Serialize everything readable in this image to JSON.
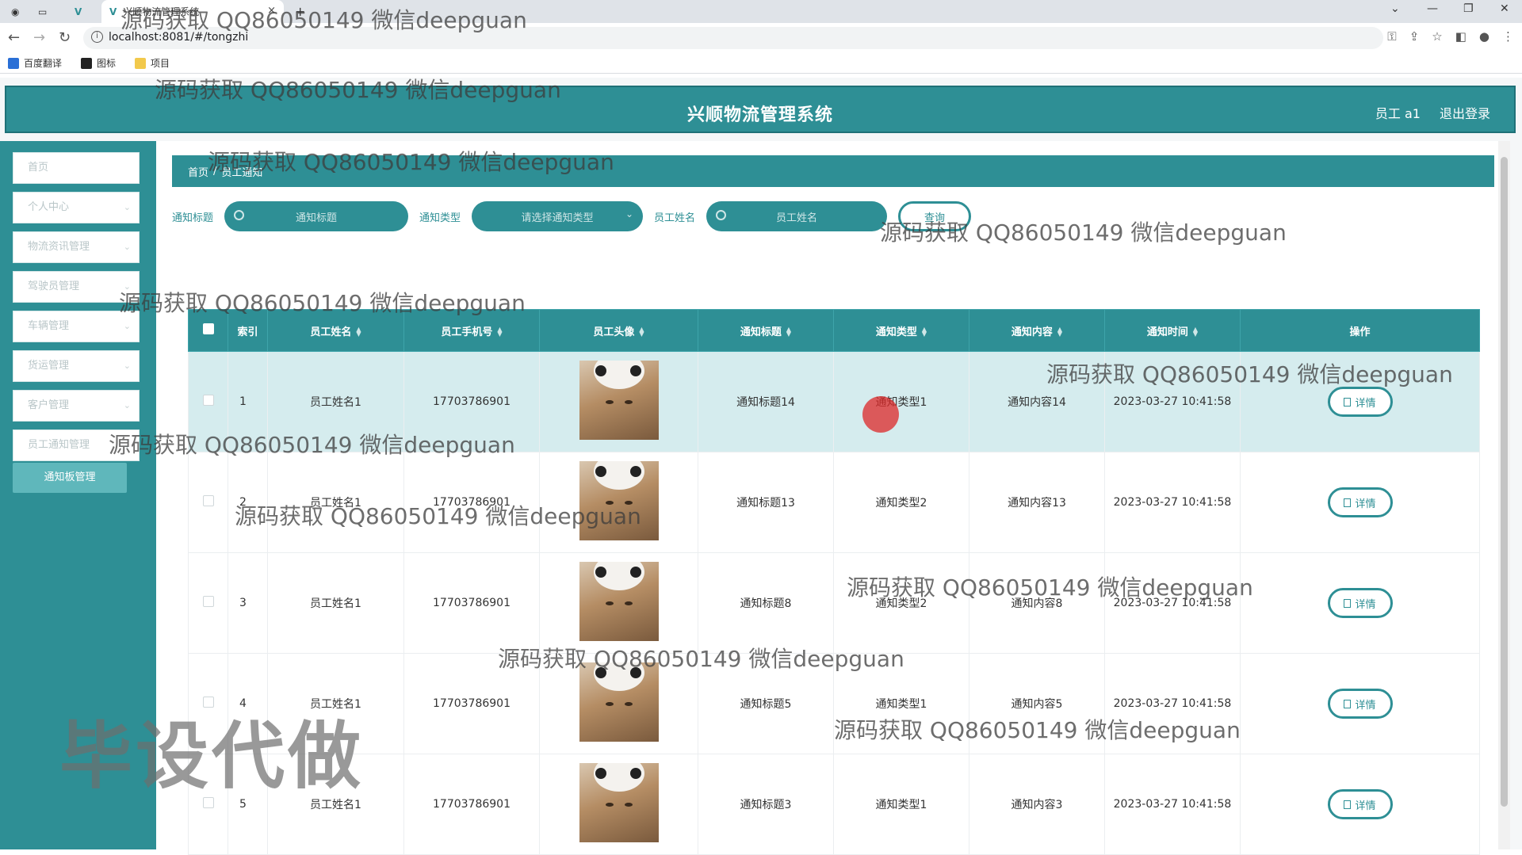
{
  "browser": {
    "tab_title": "兴顺物流管理系统",
    "tab_close": "×",
    "new_tab": "+",
    "url": "localhost:8081/#/tongzhi",
    "window_controls": [
      "⌄",
      "—",
      "❐",
      "✕"
    ]
  },
  "bookmarks": [
    {
      "label": "百度翻译",
      "color": "#2a6fd6"
    },
    {
      "label": "图标",
      "color": "#222222"
    },
    {
      "label": "项目",
      "color": "#f2c94c"
    }
  ],
  "header": {
    "title": "兴顺物流管理系统",
    "user": "员工 a1",
    "logout": "退出登录"
  },
  "sidebar": {
    "items": [
      {
        "label": "首页",
        "has_chevron": false
      },
      {
        "label": "个人中心",
        "has_chevron": true
      },
      {
        "label": "物流资讯管理",
        "has_chevron": true
      },
      {
        "label": "驾驶员管理",
        "has_chevron": true
      },
      {
        "label": "车辆管理",
        "has_chevron": true
      },
      {
        "label": "货运管理",
        "has_chevron": true
      },
      {
        "label": "客户管理",
        "has_chevron": true
      },
      {
        "label": "员工通知管理",
        "has_chevron": true
      }
    ],
    "active_sub": "通知板管理"
  },
  "breadcrumb": {
    "home": "首页",
    "sep": "/",
    "current": "员工通知"
  },
  "search": {
    "title_label": "通知标题",
    "title_placeholder": "通知标题",
    "type_label": "通知类型",
    "type_placeholder": "请选择通知类型",
    "name_label": "员工姓名",
    "name_placeholder": "员工姓名",
    "query_button": "查询"
  },
  "table": {
    "columns": [
      "索引",
      "员工姓名",
      "员工手机号",
      "员工头像",
      "通知标题",
      "通知类型",
      "通知内容",
      "通知时间",
      "操作"
    ],
    "detail_label": "详情",
    "rows": [
      {
        "index": "1",
        "name": "员工姓名1",
        "phone": "17703786901",
        "title": "通知标题14",
        "type": "通知类型1",
        "content": "通知内容14",
        "time": "2023-03-27 10:41:58"
      },
      {
        "index": "2",
        "name": "员工姓名1",
        "phone": "17703786901",
        "title": "通知标题13",
        "type": "通知类型2",
        "content": "通知内容13",
        "time": "2023-03-27 10:41:58"
      },
      {
        "index": "3",
        "name": "员工姓名1",
        "phone": "17703786901",
        "title": "通知标题8",
        "type": "通知类型2",
        "content": "通知内容8",
        "time": "2023-03-27 10:41:58"
      },
      {
        "index": "4",
        "name": "员工姓名1",
        "phone": "17703786901",
        "title": "通知标题5",
        "type": "通知类型1",
        "content": "通知内容5",
        "time": "2023-03-27 10:41:58"
      },
      {
        "index": "5",
        "name": "员工姓名1",
        "phone": "17703786901",
        "title": "通知标题3",
        "type": "通知类型1",
        "content": "通知内容3",
        "time": "2023-03-27 10:41:58"
      }
    ]
  },
  "watermarks": {
    "text": "源码获取 QQ86050149 微信deepguan",
    "big": "毕设代做"
  },
  "colors": {
    "primary": "#2e8f95",
    "row_highlight": "#d5ecee"
  }
}
